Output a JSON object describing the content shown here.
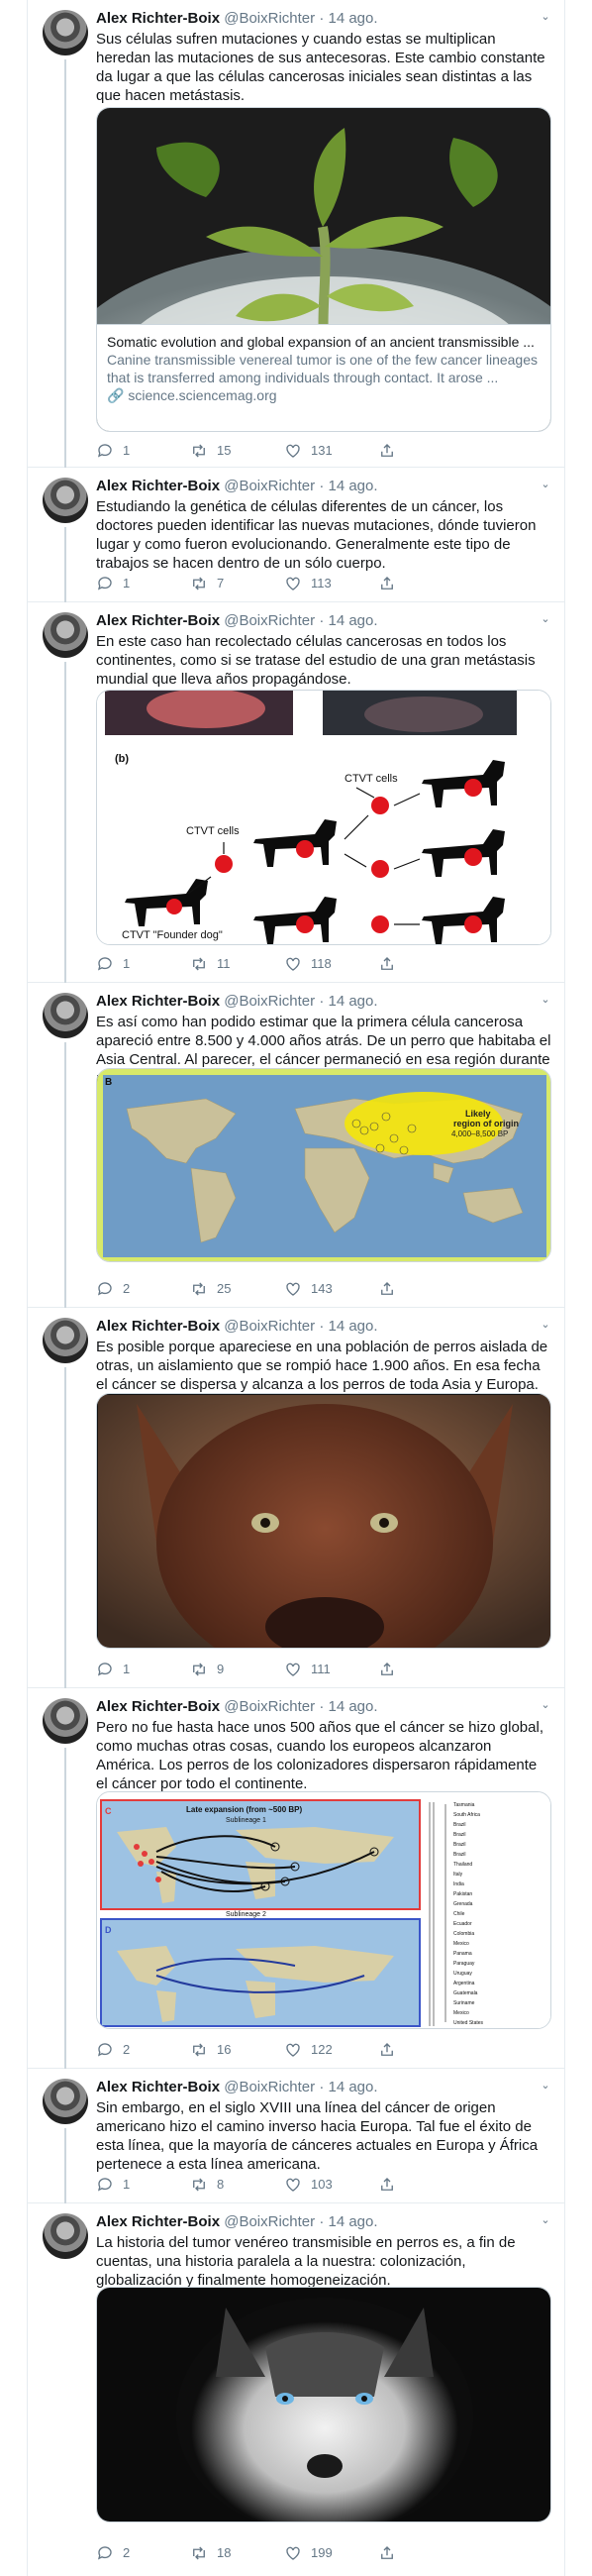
{
  "tweets": [
    {
      "name": "Alex Richter-Boix",
      "handle": "@BoixRichter",
      "date": "· 14 ago.",
      "text": "Sus células sufren mutaciones y cuando estas se multiplican heredan las mutaciones de sus antecesoras. Este cambio constante da lugar a que las células cancerosas iniciales sean distintas a las que hacen metástasis.",
      "card": {
        "title": "Somatic evolution and global expansion of an ancient transmissible ...",
        "description": "Canine transmissible venereal tumor is one of the few cancer lineages that is transferred among individuals through contact. It arose ...",
        "link": "science.sciencemag.org"
      },
      "replies": "1",
      "retweets": "15",
      "likes": "131"
    },
    {
      "name": "Alex Richter-Boix",
      "handle": "@BoixRichter",
      "date": "· 14 ago.",
      "text": "Estudiando la genética de células diferentes de un cáncer, los doctores pueden identificar las nuevas mutaciones, dónde tuvieron lugar y como fueron evolucionando. Generalmente este tipo de trabajos se hacen dentro de un sólo cuerpo.",
      "replies": "1",
      "retweets": "7",
      "likes": "113"
    },
    {
      "name": "Alex Richter-Boix",
      "handle": "@BoixRichter",
      "date": "· 14 ago.",
      "text": "En este caso han recolectado células cancerosas en todos los continentes, como si se tratase del estudio de una gran metástasis mundial que lleva años propagándose.",
      "figure": {
        "panel_label": "(b)",
        "ctvt_a": "CTVT cells",
        "ctvt_b": "CTVT cells",
        "founder": "CTVT \"Founder dog\""
      },
      "replies": "1",
      "retweets": "11",
      "likes": "118"
    },
    {
      "name": "Alex Richter-Boix",
      "handle": "@BoixRichter",
      "date": "· 14 ago.",
      "text": "Es así como han podido estimar que la primera célula cancerosa apareció entre 8.500 y 4.000 años atrás. De un perro que habitaba el Asia Central. Al parecer, el cáncer permaneció en esa región durante milenios.",
      "map": {
        "panel_label": "B",
        "region_line1": "Likely",
        "region_line2": "region of origin",
        "region_line3": "4,000–8,500 BP"
      },
      "replies": "2",
      "retweets": "25",
      "likes": "143"
    },
    {
      "name": "Alex Richter-Boix",
      "handle": "@BoixRichter",
      "date": "· 14 ago.",
      "text": "Es posible porque apareciese en una población de perros aislada de otras, un aislamiento que se rompió hace 1.900 años. En esa fecha el cáncer se dispersa y alcanza a los perros de toda Asia y Europa.",
      "replies": "1",
      "retweets": "9",
      "likes": "111"
    },
    {
      "name": "Alex Richter-Boix",
      "handle": "@BoixRichter",
      "date": "· 14 ago.",
      "text": "Pero no fue hasta hace unos 500 años que el cáncer se hizo global, como muchas otras cosas, cuando los europeos alcanzaron América. Los perros de los colonizadores dispersaron rápidamente el cáncer por todo el continente.",
      "figure2": {
        "label_c": "C",
        "label_d": "D",
        "expansion": "Late expansion (from ~500 BP)",
        "sub1": "Sublineage 1",
        "sub2": "Sublineage 2"
      },
      "replies": "2",
      "retweets": "16",
      "likes": "122"
    },
    {
      "name": "Alex Richter-Boix",
      "handle": "@BoixRichter",
      "date": "· 14 ago.",
      "text": "Sin embargo, en el siglo XVIII una línea del cáncer de origen americano hizo el camino inverso hacia Europa. Tal fue el éxito de esta línea, que la mayoría de cánceres actuales en Europa y África pertenece a esta línea americana.",
      "replies": "1",
      "retweets": "8",
      "likes": "103"
    },
    {
      "name": "Alex Richter-Boix",
      "handle": "@BoixRichter",
      "date": "· 14 ago.",
      "text": "La historia del tumor venéreo transmisible en perros es, a fin de cuentas, una historia paralela a la nuestra: colonización, globalización y finalmente homogeneización.",
      "replies": "2",
      "retweets": "18",
      "likes": "199"
    }
  ],
  "colors": {
    "text": "#14171a",
    "secondary": "#657786",
    "border": "#e6ecf0",
    "link_desc": "#657786"
  }
}
